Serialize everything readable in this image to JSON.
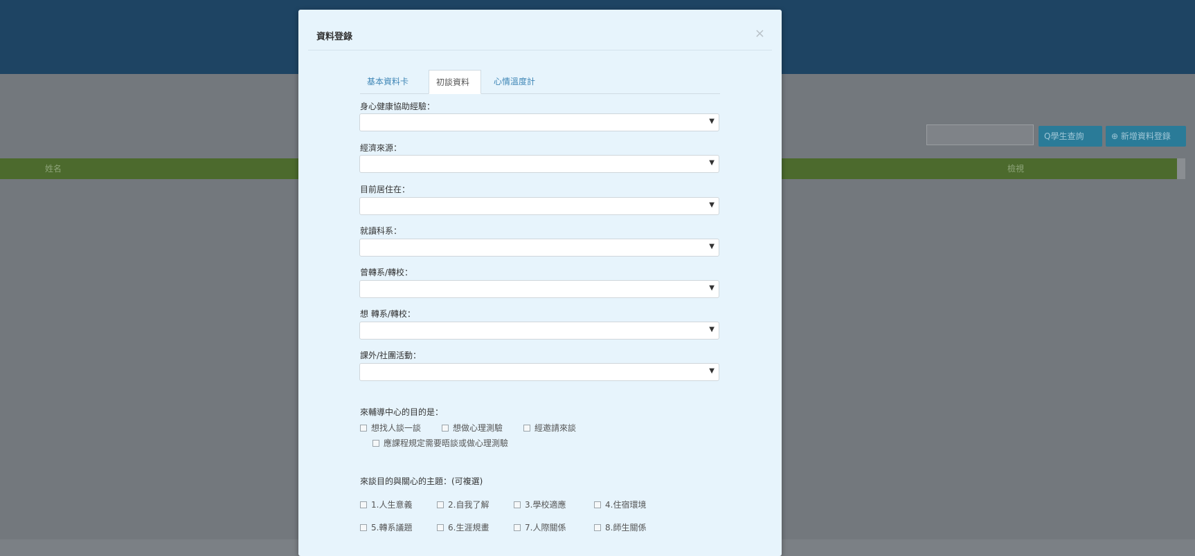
{
  "background": {
    "search_button": "Q學生查詢",
    "add_button": "⊕ 新增資料登錄",
    "table_headers": [
      "姓名",
      "檢視"
    ]
  },
  "modal": {
    "title": "資料登錄",
    "close": "×",
    "tabs": [
      "基本資料卡",
      "初談資料",
      "心情溫度計"
    ],
    "fields": [
      {
        "label": "身心健康協助經驗：",
        "value": ""
      },
      {
        "label": "經濟來源：",
        "value": ""
      },
      {
        "label": "目前居住在：",
        "value": ""
      },
      {
        "label": "就讀科系：",
        "value": ""
      },
      {
        "label": "曾轉系/轉校：",
        "value": ""
      },
      {
        "label": "想 轉系/轉校：",
        "value": ""
      },
      {
        "label": "課外/社團活動：",
        "value": ""
      }
    ],
    "purpose": {
      "label": "來輔導中心的目的是：",
      "options": [
        "想找人談一談",
        "想做心理測驗",
        "經邀請來談",
        "應課程規定需要晤談或做心理測驗"
      ]
    },
    "topics": {
      "label": "來談目的與關心的主題：(可複選)",
      "options": [
        "1.人生意義",
        "2.自我了解",
        "3.學校適應",
        "4.住宿環境",
        "5.轉系議題",
        "6.生涯規畫",
        "7.人際關係",
        "8.師生關係"
      ]
    }
  }
}
